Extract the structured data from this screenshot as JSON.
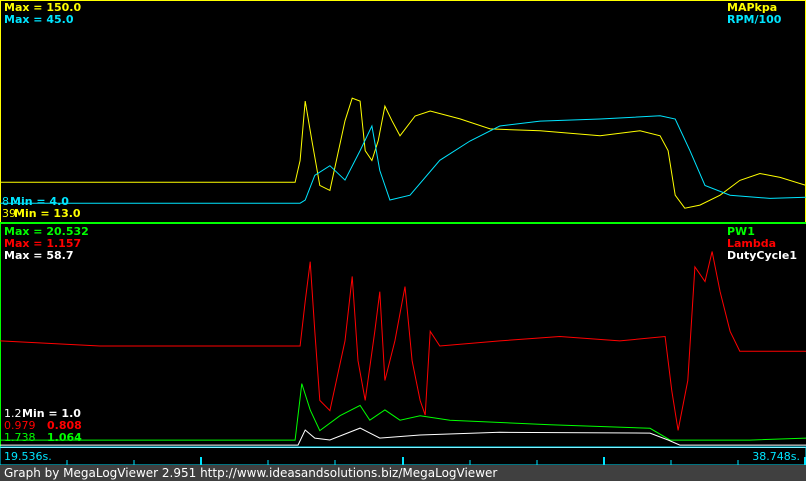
{
  "colors": {
    "map": "#ffff00",
    "rpm": "#00e5ff",
    "pw1": "#00ff00",
    "lambda": "#ff0000",
    "duty": "#ffffff",
    "axis": "#00e5ff",
    "footer_bg": "#404040"
  },
  "top_chart": {
    "series": [
      {
        "name": "MAPkpa",
        "max_label": "Max = 150.0",
        "min_label": "Min = 13.0",
        "cursor_value": "39",
        "min": 13,
        "max": 150,
        "points": [
          [
            19.54,
            37.7
          ],
          [
            26.57,
            37.7
          ],
          [
            26.69,
            51.3
          ],
          [
            26.81,
            88.3
          ],
          [
            26.97,
            63.6
          ],
          [
            27.16,
            35.8
          ],
          [
            27.4,
            32.7
          ],
          [
            27.76,
            76.0
          ],
          [
            27.93,
            90.1
          ],
          [
            28.12,
            88.3
          ],
          [
            28.24,
            57.4
          ],
          [
            28.4,
            51.3
          ],
          [
            28.55,
            63.6
          ],
          [
            28.71,
            85.2
          ],
          [
            28.88,
            76.0
          ],
          [
            29.07,
            66.7
          ],
          [
            29.43,
            79.0
          ],
          [
            29.79,
            82.1
          ],
          [
            30.5,
            77.2
          ],
          [
            31.22,
            71.0
          ],
          [
            32.41,
            69.8
          ],
          [
            33.84,
            66.7
          ],
          [
            34.79,
            69.8
          ],
          [
            35.27,
            66.7
          ],
          [
            35.46,
            57.4
          ],
          [
            35.63,
            29.7
          ],
          [
            35.86,
            21.6
          ],
          [
            36.22,
            23.5
          ],
          [
            36.7,
            29.7
          ],
          [
            37.17,
            38.9
          ],
          [
            37.65,
            43.2
          ],
          [
            38.13,
            40.8
          ],
          [
            38.75,
            35.8
          ]
        ]
      },
      {
        "name": "RPM/100",
        "max_label": "Max = 45.0",
        "min_label": "Min = 4.0",
        "cursor_value": "8",
        "min": 4,
        "max": 45,
        "points": [
          [
            19.54,
            7.5
          ],
          [
            26.69,
            7.5
          ],
          [
            26.81,
            8.1
          ],
          [
            27.04,
            12.7
          ],
          [
            27.4,
            14.5
          ],
          [
            27.76,
            11.8
          ],
          [
            28.12,
            17.3
          ],
          [
            28.4,
            21.9
          ],
          [
            28.59,
            13.6
          ],
          [
            28.83,
            8.1
          ],
          [
            29.31,
            9.0
          ],
          [
            30.02,
            15.5
          ],
          [
            30.74,
            19.1
          ],
          [
            31.45,
            21.9
          ],
          [
            32.41,
            22.8
          ],
          [
            33.84,
            23.2
          ],
          [
            35.27,
            23.8
          ],
          [
            35.63,
            23.2
          ],
          [
            35.98,
            17.3
          ],
          [
            36.34,
            10.8
          ],
          [
            36.94,
            9.0
          ],
          [
            37.89,
            8.4
          ],
          [
            38.75,
            8.6
          ]
        ]
      }
    ]
  },
  "bottom_chart": {
    "series": [
      {
        "name": "PW1",
        "max_label": "Max = 20.532",
        "min_label": "1.064",
        "cursor_value": "1.738",
        "min": 1.064,
        "max": 20.532,
        "points": [
          [
            19.54,
            1.67
          ],
          [
            26.57,
            1.67
          ],
          [
            26.73,
            6.6
          ],
          [
            26.93,
            4.3
          ],
          [
            27.16,
            2.5
          ],
          [
            27.64,
            3.8
          ],
          [
            28.12,
            4.7
          ],
          [
            28.35,
            3.4
          ],
          [
            28.71,
            4.3
          ],
          [
            29.07,
            3.4
          ],
          [
            29.55,
            3.8
          ],
          [
            30.26,
            3.4
          ],
          [
            32.65,
            3.0
          ],
          [
            35.03,
            2.7
          ],
          [
            35.51,
            1.67
          ],
          [
            36.22,
            1.67
          ],
          [
            37.41,
            1.67
          ],
          [
            38.75,
            1.84
          ]
        ]
      },
      {
        "name": "Lambda",
        "max_label": "Max = 1.157",
        "min_label": "0.808",
        "cursor_value": "0.979",
        "min": 0.808,
        "max": 1.157,
        "points": [
          [
            19.54,
            0.974
          ],
          [
            21.92,
            0.966
          ],
          [
            24.3,
            0.966
          ],
          [
            26.69,
            0.966
          ],
          [
            26.81,
            1.036
          ],
          [
            26.93,
            1.098
          ],
          [
            27.04,
            0.989
          ],
          [
            27.16,
            0.881
          ],
          [
            27.4,
            0.865
          ],
          [
            27.76,
            0.974
          ],
          [
            27.93,
            1.075
          ],
          [
            28.07,
            0.943
          ],
          [
            28.24,
            0.881
          ],
          [
            28.47,
            0.989
          ],
          [
            28.59,
            1.051
          ],
          [
            28.71,
            0.912
          ],
          [
            28.95,
            0.974
          ],
          [
            29.19,
            1.059
          ],
          [
            29.36,
            0.943
          ],
          [
            29.55,
            0.881
          ],
          [
            29.67,
            0.858
          ],
          [
            29.79,
            0.989
          ],
          [
            30.02,
            0.966
          ],
          [
            31.45,
            0.974
          ],
          [
            32.88,
            0.981
          ],
          [
            34.31,
            0.974
          ],
          [
            35.39,
            0.981
          ],
          [
            35.55,
            0.896
          ],
          [
            35.7,
            0.834
          ],
          [
            35.93,
            0.912
          ],
          [
            36.1,
            1.09
          ],
          [
            36.34,
            1.067
          ],
          [
            36.51,
            1.114
          ],
          [
            36.7,
            1.051
          ],
          [
            36.94,
            0.989
          ],
          [
            37.17,
            0.958
          ],
          [
            38.75,
            0.958
          ]
        ]
      },
      {
        "name": "DutyCycle1",
        "max_label": "Max = 58.7",
        "min_label": "Min = 1.0",
        "cursor_value": "1.2",
        "min": 1.0,
        "max": 58.7,
        "points": [
          [
            19.54,
            1.5
          ],
          [
            26.64,
            1.5
          ],
          [
            26.81,
            5.4
          ],
          [
            27.04,
            3.3
          ],
          [
            27.4,
            2.8
          ],
          [
            28.12,
            5.9
          ],
          [
            28.59,
            3.3
          ],
          [
            29.55,
            4.1
          ],
          [
            31.45,
            4.8
          ],
          [
            35.03,
            4.6
          ],
          [
            35.46,
            2.8
          ],
          [
            35.74,
            1.5
          ],
          [
            38.75,
            1.5
          ]
        ]
      }
    ]
  },
  "time_axis": {
    "start": 19.536,
    "end": 38.748,
    "start_label": "19.536s.",
    "end_label": "38.748s."
  },
  "footer": "Graph by MegaLogViewer 2.951 http://www.ideasandsolutions.biz/MegaLogViewer"
}
